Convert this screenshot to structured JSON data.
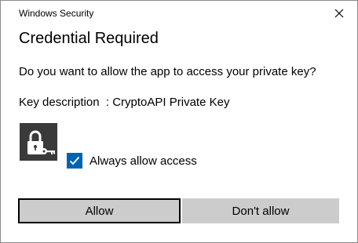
{
  "window": {
    "title": "Windows Security",
    "close_icon": "close-icon"
  },
  "content": {
    "heading": "Credential Required",
    "prompt": "Do you want to allow the app to access your private key?",
    "key_description": "Key description  : CryptoAPI Private Key",
    "key_icon": "lock-key-icon"
  },
  "checkbox": {
    "label": "Always allow access",
    "checked": true,
    "color": "#0063b1"
  },
  "buttons": {
    "allow": "Allow",
    "deny": "Don't allow"
  }
}
